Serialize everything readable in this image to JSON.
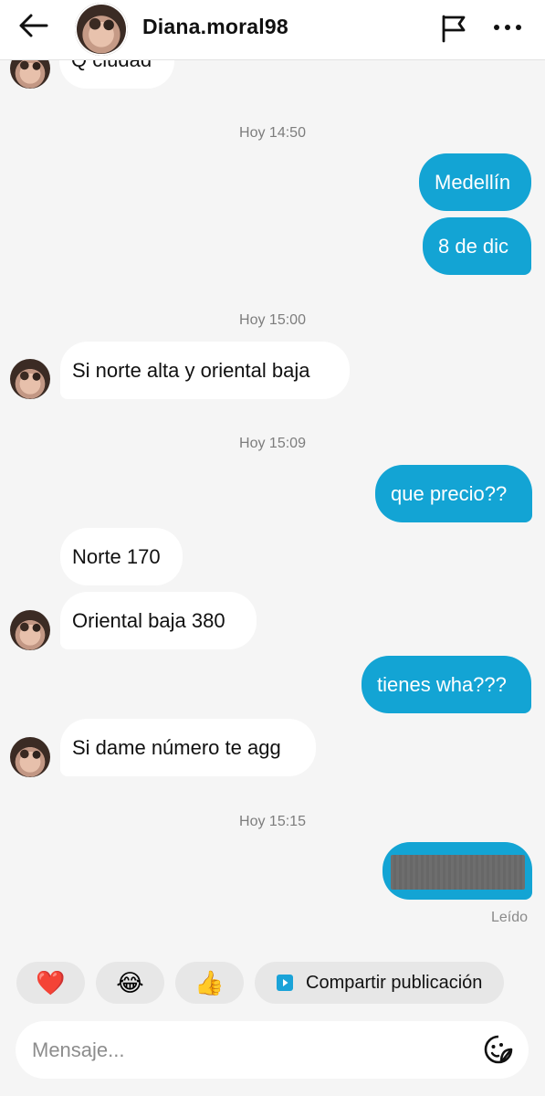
{
  "header": {
    "username": "Diana.moral98",
    "back_icon": "arrow-left-icon",
    "flag_icon": "flag-icon",
    "more_icon": "more-horizontal-icon"
  },
  "messages": [
    {
      "type": "partial_incoming",
      "text": "Q ciudad"
    },
    {
      "type": "timestamp",
      "text": "Hoy 14:50"
    },
    {
      "type": "outgoing",
      "text": "Medellín"
    },
    {
      "type": "outgoing",
      "text": "8 de dic"
    },
    {
      "type": "timestamp",
      "text": "Hoy 15:00"
    },
    {
      "type": "incoming",
      "text": "Si norte alta y oriental baja"
    },
    {
      "type": "timestamp",
      "text": "Hoy 15:09"
    },
    {
      "type": "outgoing",
      "text": "que precio??"
    },
    {
      "type": "incoming",
      "text": "Norte 170"
    },
    {
      "type": "incoming",
      "text": "Oriental baja 380"
    },
    {
      "type": "outgoing",
      "text": "tienes wha???"
    },
    {
      "type": "incoming",
      "text": "Si dame número te agg"
    },
    {
      "type": "timestamp",
      "text": "Hoy 15:15"
    },
    {
      "type": "outgoing_redacted",
      "text": ""
    }
  ],
  "read_receipt": "Leído",
  "quick_replies": [
    {
      "emoji": "❤️",
      "icon": "heart-icon"
    },
    {
      "emoji": "😂",
      "icon": "laughing-icon"
    },
    {
      "emoji": "👍",
      "icon": "thumbs-up-icon"
    }
  ],
  "share_post_label": "Compartir publicación",
  "composer": {
    "placeholder": "Mensaje...",
    "value": "",
    "sticker_icon": "sticker-icon"
  },
  "colors": {
    "outgoing_bubble": "#13a4d4",
    "incoming_bubble": "#ffffff",
    "background": "#f5f5f5",
    "timestamp_text": "#7d7d7d",
    "share_icon": "#1aa3d8"
  }
}
